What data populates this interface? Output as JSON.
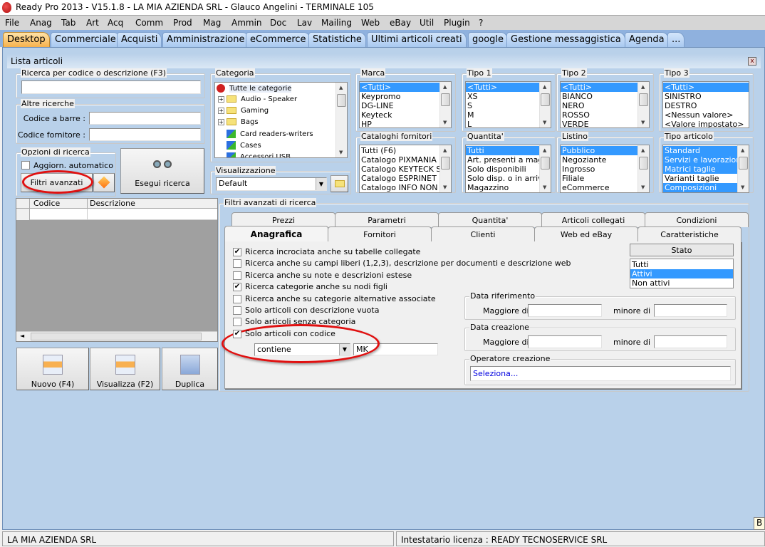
{
  "window": {
    "title": "Ready Pro 2013 - V15.1.8 - LA MIA AZIENDA SRL - Glauco Angelini - TERMINALE 105"
  },
  "menu": [
    "File",
    "Anag",
    "Tab",
    "Art",
    "Acq",
    "Comm",
    "Prod",
    "Mag",
    "Ammin",
    "Doc",
    "Lav",
    "Mailing",
    "Web",
    "eBay",
    "Util",
    "Plugin",
    "?"
  ],
  "tabs": [
    "Desktop",
    "Commerciale",
    "Acquisti",
    "Amministrazione",
    "eCommerce",
    "Statistiche",
    "Ultimi articoli creati",
    "google",
    "Gestione messaggistica",
    "Agenda",
    "..."
  ],
  "panel": {
    "title": "Lista articoli",
    "close": "x"
  },
  "search": {
    "legend": "Ricerca per codice o descrizione (F3)",
    "value": ""
  },
  "altre": {
    "legend": "Altre ricerche",
    "barcode_label": "Codice a barre :",
    "supplier_label": "Codice fornitore :"
  },
  "opzioni": {
    "legend": "Opzioni di ricerca",
    "auto_update": "Aggiorn. automatico",
    "auto_checked": false,
    "filters_button": "Filtri avanzati"
  },
  "esegui": "Esegui ricerca",
  "categoria": {
    "legend": "Categoria",
    "root": "Tutte le categorie",
    "items": [
      "Audio - Speaker",
      "Gaming",
      "Bags",
      "Card readers-writers",
      "Cases",
      "Accessori USB"
    ]
  },
  "visualizzazione": {
    "legend": "Visualizzazione",
    "value": "Default"
  },
  "lists": [
    {
      "legend": "Marca",
      "items": [
        "<Tutti>",
        "Keypromo",
        "DG-LINE",
        "Keyteck",
        "HP"
      ],
      "selected": [
        0
      ]
    },
    {
      "legend": "Tipo 1",
      "items": [
        "<Tutti>",
        "XS",
        "S",
        "M",
        "L"
      ],
      "selected": [
        0
      ]
    },
    {
      "legend": "Tipo 2",
      "items": [
        "<Tutti>",
        "BIANCO",
        "NERO",
        "ROSSO",
        "VERDE"
      ],
      "selected": [
        0
      ]
    },
    {
      "legend": "Tipo 3",
      "items": [
        "<Tutti>",
        "SINISTRO",
        "DESTRO",
        "<Nessun valore>",
        "<Valore impostato>"
      ],
      "selected": [
        0
      ]
    },
    {
      "legend": "Cataloghi fornitori",
      "items": [
        "Tutti (F6)",
        "Catalogo PIXMANIA",
        "Catalogo KEYTECK SRL",
        "Catalogo ESPRINET SPA",
        "Catalogo INFO NON SI"
      ],
      "selected": []
    },
    {
      "legend": "Quantita'",
      "items": [
        "Tutti",
        "Art. presenti a magazzino",
        "Solo disponibili",
        "Solo disp. o in arrivo",
        "Magazzino"
      ],
      "selected": [
        0
      ]
    },
    {
      "legend": "Listino",
      "items": [
        "Pubblico",
        "Negoziante",
        "Ingrosso",
        "Filiale",
        "eCommerce"
      ],
      "selected": [
        0
      ]
    },
    {
      "legend": "Tipo articolo",
      "items": [
        "Standard",
        "Servizi e lavorazioni",
        "Matrici taglie",
        "Varianti taglie",
        "Composizioni"
      ],
      "selected": [
        0,
        1,
        2,
        4
      ]
    }
  ],
  "grid": {
    "columns": [
      "Codice",
      "Descrizione"
    ]
  },
  "actions": [
    "Nuovo (F4)",
    "Visualizza (F2)",
    "Duplica"
  ],
  "filtri": {
    "legend": "Filtri avanzati di ricerca",
    "tabs_row1": [
      "Prezzi",
      "Parametri",
      "Quantita'",
      "Articoli collegati",
      "Condizioni"
    ],
    "tabs_row2": [
      "Anagrafica",
      "Fornitori",
      "Clienti",
      "Web ed eBay",
      "Caratteristiche"
    ],
    "active_tab": "Anagrafica",
    "checks": [
      {
        "label": "Ricerca incrociata anche su tabelle collegate",
        "checked": true
      },
      {
        "label": "Ricerca anche su campi liberi (1,2,3), descrizione per documenti e descrizione web",
        "checked": false
      },
      {
        "label": "Ricerca anche su note e descrizioni estese",
        "checked": false
      },
      {
        "label": "Ricerca categorie anche su nodi figli",
        "checked": true
      },
      {
        "label": "Ricerca anche su categorie alternative associate",
        "checked": false
      },
      {
        "label": "Solo articoli con descrizione vuota",
        "checked": false
      },
      {
        "label": "Solo articoli senza categoria",
        "checked": false
      },
      {
        "label": "Solo articoli con codice",
        "checked": true
      }
    ],
    "code_operator": "contiene",
    "code_value": "MK",
    "stato": {
      "header": "Stato",
      "items": [
        "Tutti",
        "Attivi",
        "Non attivi"
      ],
      "selected": 1
    },
    "data_rif": {
      "legend": "Data riferimento",
      "from": "Maggiore di",
      "to": "minore di"
    },
    "data_cre": {
      "legend": "Data creazione",
      "from": "Maggiore di",
      "to": "minore di"
    },
    "operatore": {
      "legend": "Operatore creazione",
      "value": "Seleziona..."
    }
  },
  "status": {
    "left": "LA MIA AZIENDA SRL",
    "right": "Intestatario licenza : READY TECNOSERVICE SRL",
    "tip": "B"
  },
  "colors": {
    "selection": "#3399ff",
    "active_tab": "#f6b14c",
    "highlight": "#e01010"
  }
}
